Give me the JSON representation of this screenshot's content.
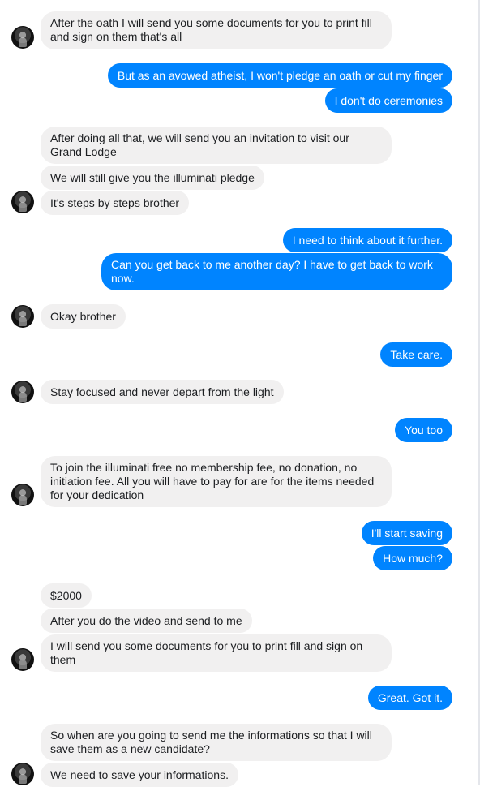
{
  "messages": [
    {
      "from": "them",
      "text": "After the oath I will send you some documents for you to print fill and sign on them that's all"
    },
    {
      "from": "me",
      "text": "But as an avowed atheist, I won't pledge an oath or cut my finger"
    },
    {
      "from": "me",
      "text": "I don't do ceremonies"
    },
    {
      "from": "them",
      "text": "After doing all that, we will send you an invitation to visit our Grand Lodge"
    },
    {
      "from": "them",
      "text": "We will still give you the illuminati pledge"
    },
    {
      "from": "them",
      "text": "It's steps by steps brother"
    },
    {
      "from": "me",
      "text": "I need to think about it further."
    },
    {
      "from": "me",
      "text": "Can you get back to me another day? I have to get back to work now."
    },
    {
      "from": "them",
      "text": "Okay brother"
    },
    {
      "from": "me",
      "text": "Take care."
    },
    {
      "from": "them",
      "text": "Stay focused and never depart from the light"
    },
    {
      "from": "me",
      "text": "You too"
    },
    {
      "from": "them",
      "text": "To join the illuminati free no membership fee, no donation, no initiation fee. All you will have to pay for are for the items needed for your dedication"
    },
    {
      "from": "me",
      "text": "I'll start saving"
    },
    {
      "from": "me",
      "text": "How much?"
    },
    {
      "from": "them",
      "text": "$2000"
    },
    {
      "from": "them",
      "text": "After you do the video and send to me"
    },
    {
      "from": "them",
      "text": "I will send you some documents for you to print fill and sign on them"
    },
    {
      "from": "me",
      "text": "Great. Got it."
    },
    {
      "from": "them",
      "text": "So when are you going to send me the informations so that I will save them as a new candidate?"
    },
    {
      "from": "them",
      "text": "We need to save your informations."
    }
  ],
  "colors": {
    "incoming_bubble": "#f1f0f0",
    "outgoing_bubble": "#0084ff",
    "outgoing_text": "#ffffff",
    "incoming_text": "#1c1e21"
  },
  "icons": {
    "avatar": "contact-avatar-icon"
  }
}
